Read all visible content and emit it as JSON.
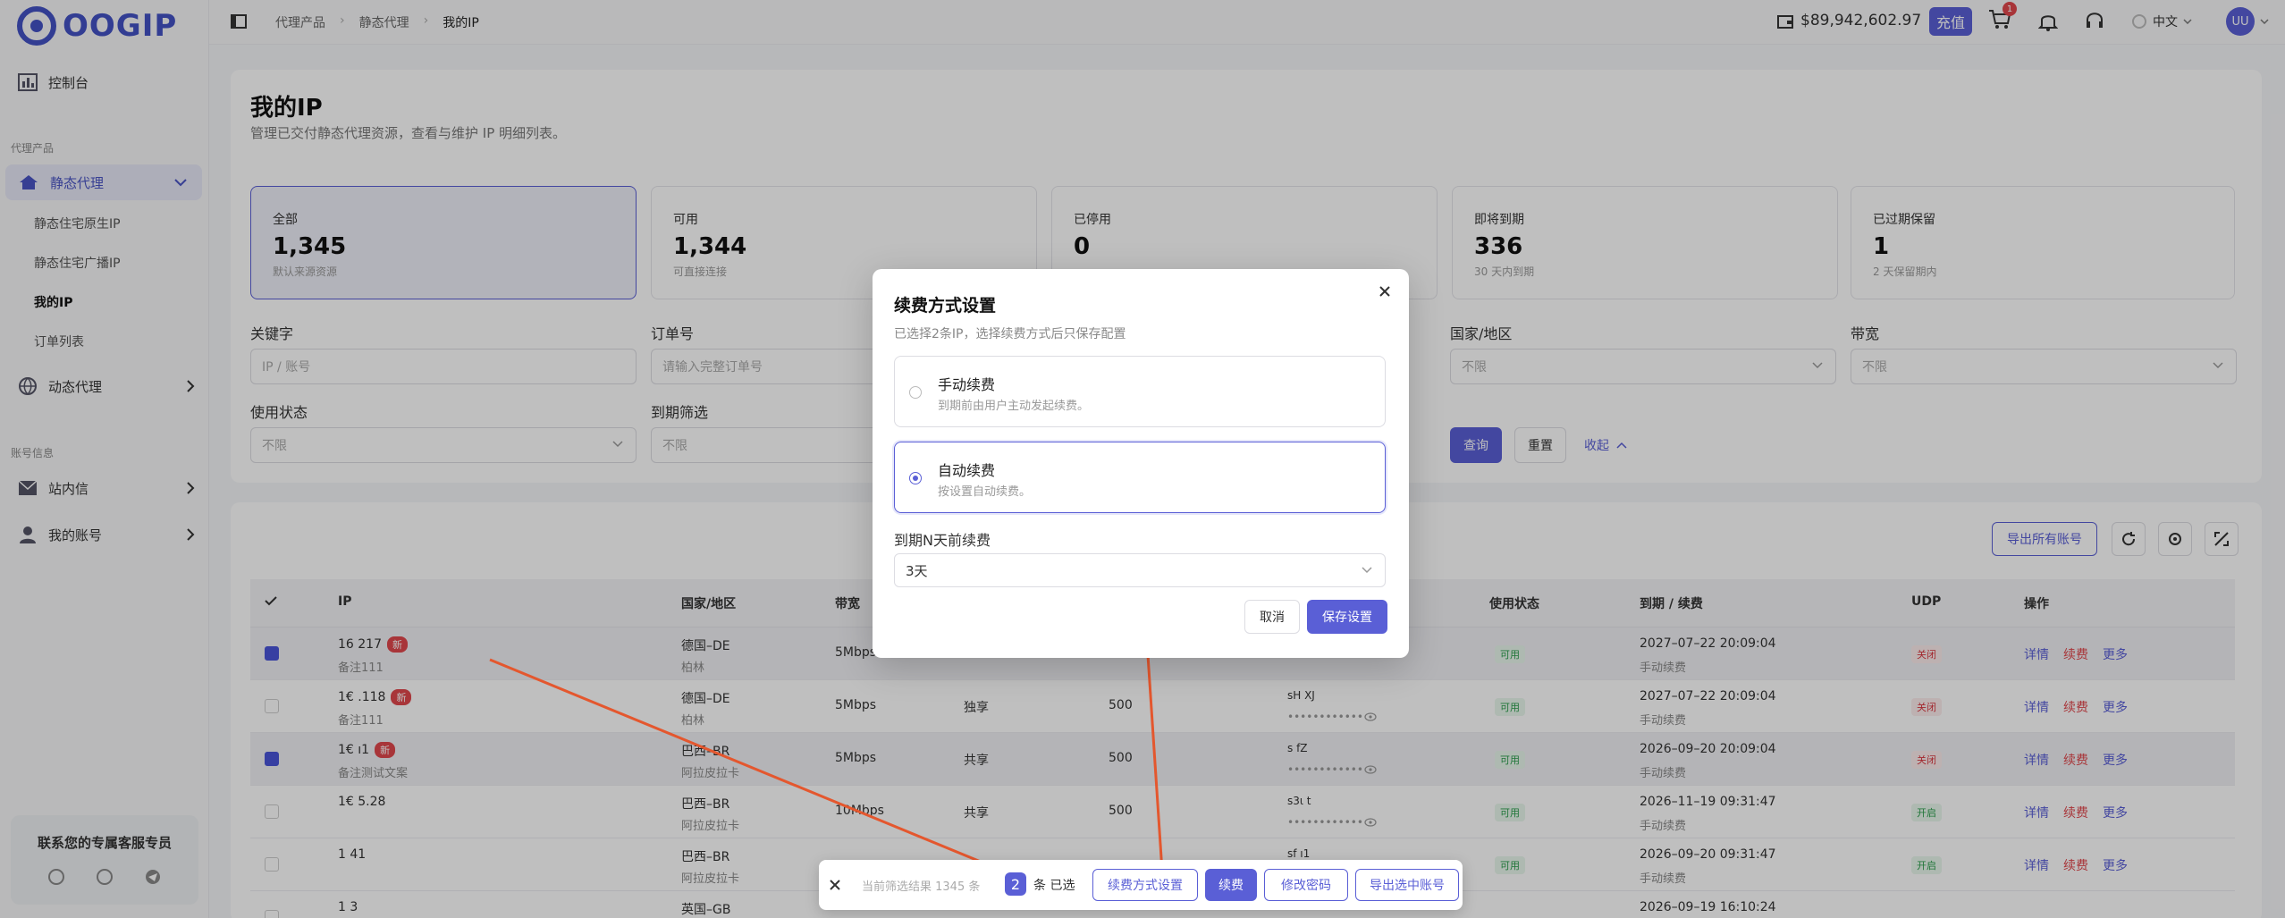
{
  "brand": {
    "logo_text": "OOGIP",
    "accent": "#5a5fd6"
  },
  "sidebar": {
    "console": "控制台",
    "section_products": "代理产品",
    "static_proxy": "静态代理",
    "sub_items": [
      "静态住宅原生IP",
      "静态住宅广播IP",
      "我的IP",
      "订单列表"
    ],
    "dynamic_proxy": "动态代理",
    "section_account": "账号信息",
    "inbox": "站内信",
    "my_account": "我的账号",
    "support_title": "联系您的专属客服专员"
  },
  "header": {
    "breadcrumb": [
      "代理产品",
      "静态代理",
      "我的IP"
    ],
    "balance": "$89,942,602.97",
    "recharge": "充值",
    "cart_count": "1",
    "language": "中文",
    "avatar": "UU"
  },
  "page": {
    "title": "我的IP",
    "subtitle": "管理已交付静态代理资源，查看与维护 IP 明细列表。"
  },
  "stats": [
    {
      "label": "全部",
      "value": "1,345",
      "sub": "默认来源资源"
    },
    {
      "label": "可用",
      "value": "1,344",
      "sub": "可直接连接"
    },
    {
      "label": "已停用",
      "value": "0",
      "sub": ""
    },
    {
      "label": "即将到期",
      "value": "336",
      "sub": "30 天内到期"
    },
    {
      "label": "已过期保留",
      "value": "1",
      "sub": "2 天保留期内"
    }
  ],
  "filters": {
    "keyword": {
      "label": "关键字",
      "placeholder": "IP / 账号"
    },
    "order": {
      "label": "订单号",
      "placeholder": "请输入完整订单号"
    },
    "country": {
      "label": "国家/地区",
      "value": "不限"
    },
    "bandwidth": {
      "label": "带宽",
      "value": "不限"
    },
    "usage": {
      "label": "使用状态",
      "value": "不限"
    },
    "expiry": {
      "label": "到期筛选",
      "value": "不限"
    },
    "query": "查询",
    "reset": "重置",
    "collapse": "收起"
  },
  "toolbar": {
    "export_all": "导出所有账号"
  },
  "table": {
    "headers": {
      "ip": "IP",
      "country": "国家/地区",
      "bandwidth": "带宽",
      "status": "使用状态",
      "expiry": "到期 / 续费",
      "udp": "UDP",
      "actions": "操作"
    },
    "rows": [
      {
        "ip": "16          217",
        "note": "备注111",
        "isnew": true,
        "checked": true,
        "country": "德国–DE",
        "city": "柏林",
        "bw": "5Mbps",
        "type": "",
        "num": "",
        "acct": "",
        "status": "可用",
        "expiry": "2027–07–22 20:09:04",
        "renew": "手动续费",
        "udp": "关闭"
      },
      {
        "ip": "1€          .118",
        "note": "备注111",
        "isnew": true,
        "checked": false,
        "country": "德国–DE",
        "city": "柏林",
        "bw": "5Mbps",
        "type": "独享",
        "num": "500",
        "acct": "sH          XJ",
        "status": "可用",
        "expiry": "2027–07–22 20:09:04",
        "renew": "手动续费",
        "udp": "关闭"
      },
      {
        "ip": "1€          ı1",
        "note": "备注测试文案",
        "isnew": true,
        "checked": true,
        "country": "巴西–BR",
        "city": "阿拉皮拉卡",
        "bw": "5Mbps",
        "type": "共享",
        "num": "500",
        "acct": "s          fZ",
        "status": "可用",
        "expiry": "2026–09–20 20:09:04",
        "renew": "手动续费",
        "udp": "关闭"
      },
      {
        "ip": "1€          5.28",
        "note": "",
        "isnew": false,
        "checked": false,
        "country": "巴西–BR",
        "city": "阿拉皮拉卡",
        "bw": "10Mbps",
        "type": "共享",
        "num": "500",
        "acct": "s3ι          t",
        "status": "可用",
        "expiry": "2026–11–19 09:31:47",
        "renew": "手动续费",
        "udp": "开启"
      },
      {
        "ip": "1          41",
        "note": "",
        "isnew": false,
        "checked": false,
        "country": "巴西–BR",
        "city": "阿拉皮拉卡",
        "bw": "",
        "type": "",
        "num": "",
        "acct": "sf          ı1",
        "status": "可用",
        "expiry": "2026–09–20 09:31:47",
        "renew": "手动续费",
        "udp": "开启"
      },
      {
        "ip": "1          3",
        "note": "",
        "isnew": false,
        "checked": false,
        "country": "英国–GB",
        "city": "",
        "bw": "",
        "type": "",
        "num": "",
        "acct": "",
        "status": "",
        "expiry": "2026–09–19 16:10:24",
        "renew": "",
        "udp": ""
      }
    ],
    "actions": [
      "详情",
      "续费",
      "更多"
    ],
    "new_tag": "新"
  },
  "modal": {
    "title": "续费方式设置",
    "subtitle": "已选择2条IP，选择续费方式后只保存配置",
    "opt_manual": {
      "title": "手动续费",
      "desc": "到期前由用户主动发起续费。"
    },
    "opt_auto": {
      "title": "自动续费",
      "desc": "按设置自动续费。"
    },
    "days_label": "到期N天前续费",
    "days_value": "3天",
    "cancel": "取消",
    "save": "保存设置"
  },
  "bottom_bar": {
    "filter_result": "当前筛选结果 1345 条",
    "selected_count": "2",
    "selected_suffix": "条 已选",
    "renew_settings": "续费方式设置",
    "renew": "续费",
    "change_password": "修改密码",
    "export_selected": "导出选中账号"
  }
}
